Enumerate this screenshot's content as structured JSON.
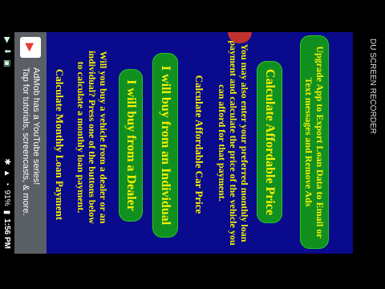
{
  "status_bar": {
    "time": "1:56 PM",
    "battery": "91%",
    "icons": [
      "battery-icon",
      "signal-icon",
      "wifi-icon",
      "bluetooth-icon"
    ]
  },
  "ad_banner": {
    "title": "AdMob has a YouTube series!",
    "subtitle": "Tap for tutorials, screencasts, & more."
  },
  "app": {
    "section1": {
      "heading": "Calculate Monthly Loan Payment",
      "text": "Will you buy a vehicle from a dealer or an individual? Press one of the buttons below to calculate a monthly loan payment."
    },
    "buttons": {
      "dealer": "I will buy from a Dealer",
      "individual": "I will buy from an Individual"
    },
    "section2": {
      "heading": "Calculate Affordable Car Price",
      "text": "You may also enter your preferred monthly loan payment and calculate the price of the vehicle you can afford for that payment."
    },
    "calc_button": "Calculate Affordable Price",
    "upgrade_button": "Upgrade App to Export Loan Data to Email or Text messages and Remove Ads"
  },
  "recorder_label": "DU SCREEN RECORDER",
  "colors": {
    "app_bg": "#0a0a8c",
    "text": "#f5f300",
    "button": "#118f1f"
  }
}
